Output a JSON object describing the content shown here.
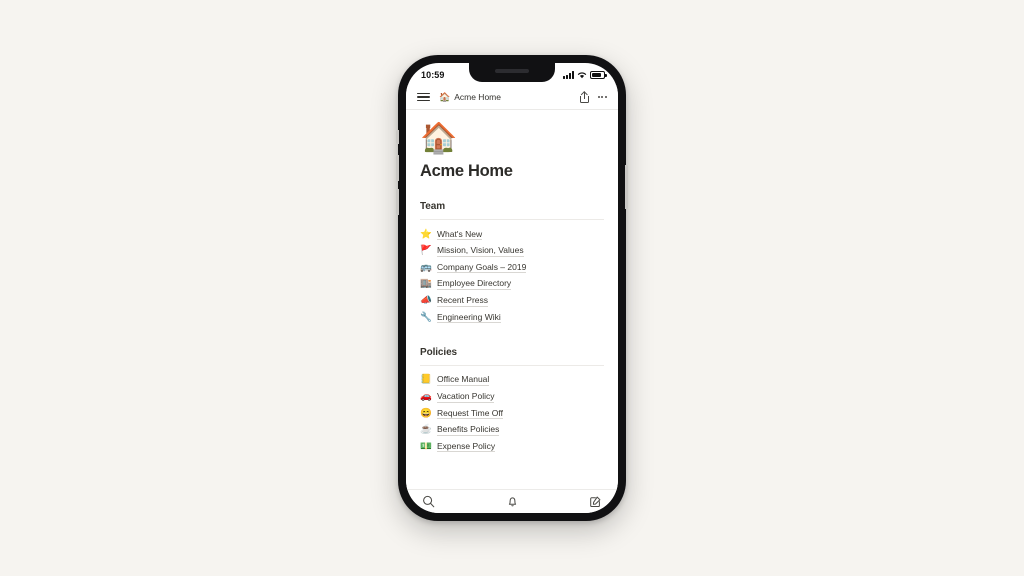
{
  "device": {
    "status_bar": {
      "time": "10:59",
      "signal_icon": "cellular-signal-icon",
      "wifi_icon": "wifi-icon",
      "battery_icon": "battery-icon"
    },
    "home_indicator": "home-indicator"
  },
  "app_header": {
    "menu_icon": "hamburger-menu-icon",
    "breadcrumb_emoji": "🏠",
    "breadcrumb_label": "Acme Home",
    "share_icon": "share-icon",
    "more_icon": "more-options-icon"
  },
  "page": {
    "icon": "🏠",
    "title": "Acme Home",
    "sections": [
      {
        "heading": "Team",
        "links": [
          {
            "emoji": "⭐",
            "label": "What's New"
          },
          {
            "emoji": "🚩",
            "label": "Mission, Vision, Values"
          },
          {
            "emoji": "🚌",
            "label": "Company Goals – 2019"
          },
          {
            "emoji": "🏬",
            "label": "Employee Directory"
          },
          {
            "emoji": "📣",
            "label": "Recent Press"
          },
          {
            "emoji": "🔧",
            "label": "Engineering Wiki"
          }
        ]
      },
      {
        "heading": "Policies",
        "links": [
          {
            "emoji": "📒",
            "label": "Office Manual"
          },
          {
            "emoji": "🚗",
            "label": "Vacation Policy"
          },
          {
            "emoji": "😄",
            "label": "Request Time Off"
          },
          {
            "emoji": "☕",
            "label": "Benefits Policies"
          },
          {
            "emoji": "💵",
            "label": "Expense Policy"
          }
        ]
      }
    ]
  },
  "bottom_bar": {
    "search_icon": "search-icon",
    "notifications_icon": "bell-icon",
    "compose_icon": "compose-icon"
  },
  "colors": {
    "page_background": "#f6f4f0",
    "screen_background": "#ffffff",
    "text_primary": "#37352f",
    "frame": "#111113"
  }
}
